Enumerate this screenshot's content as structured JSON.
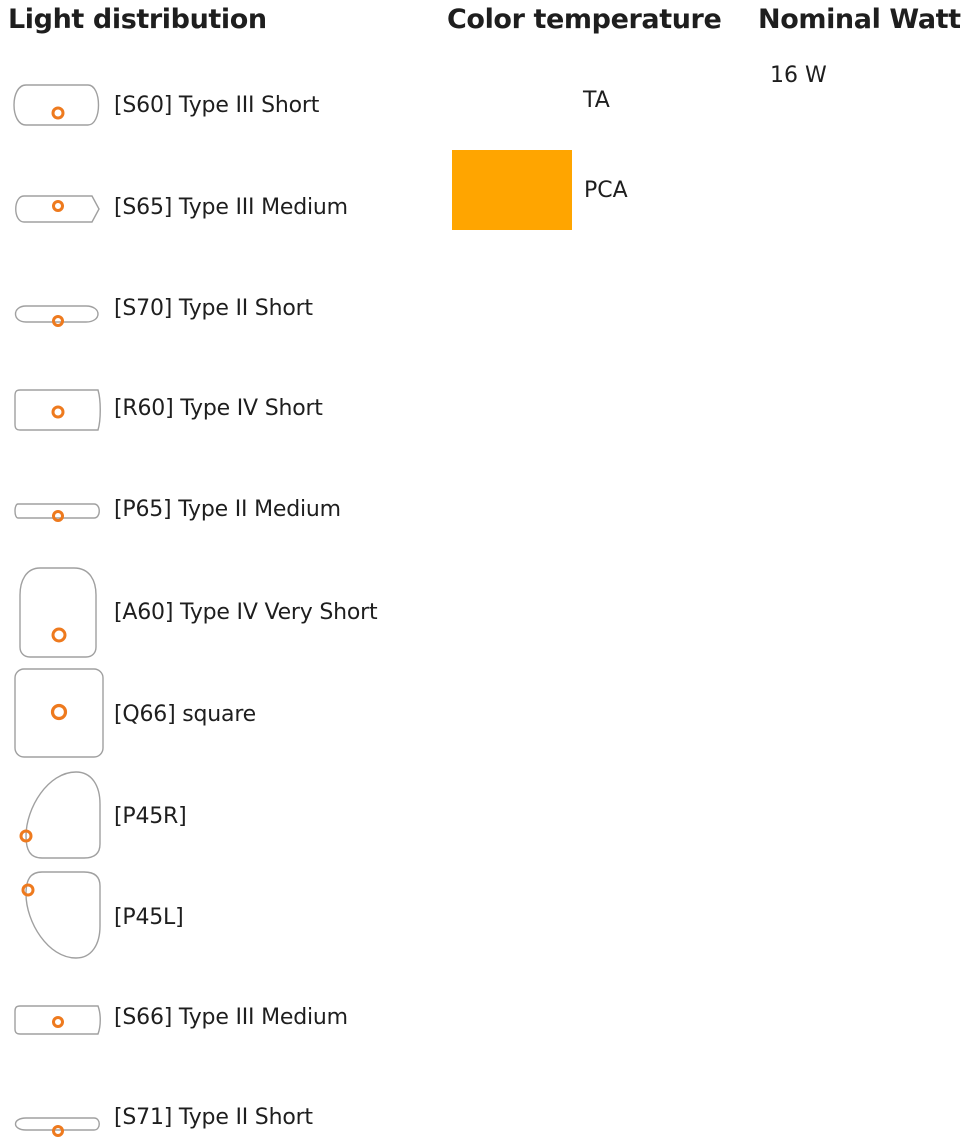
{
  "headings": {
    "light_distribution": "Light distribution",
    "color_temperature": "Color temperature",
    "nominal_watt": "Nominal Watt"
  },
  "light_distribution": [
    {
      "label": "[S60] Type III Short",
      "icon": "s60-distribution-icon"
    },
    {
      "label": "[S65] Type III Medium",
      "icon": "s65-distribution-icon"
    },
    {
      "label": "[S70] Type II Short",
      "icon": "s70-distribution-icon"
    },
    {
      "label": "[R60] Type IV Short",
      "icon": "r60-distribution-icon"
    },
    {
      "label": "[P65] Type II Medium",
      "icon": "p65-distribution-icon"
    },
    {
      "label": "[A60] Type IV Very Short",
      "icon": "a60-distribution-icon"
    },
    {
      "label": "[Q66] square",
      "icon": "q66-distribution-icon"
    },
    {
      "label": "[P45R]",
      "icon": "p45r-distribution-icon"
    },
    {
      "label": "[P45L]",
      "icon": "p45l-distribution-icon"
    },
    {
      "label": "[S66] Type III Medium",
      "icon": "s66-distribution-icon"
    },
    {
      "label": "[S71] Type II Short",
      "icon": "s71-distribution-icon"
    }
  ],
  "color_temperature": [
    {
      "label": "TA"
    },
    {
      "label": "PCA",
      "swatch_color": "#FFA500"
    }
  ],
  "nominal_watt": [
    "16 W"
  ],
  "colors": {
    "icon_outline": "#a0a0a0",
    "luminaire_marker": "#ee7a1e",
    "pca_swatch": "#FFA500"
  }
}
